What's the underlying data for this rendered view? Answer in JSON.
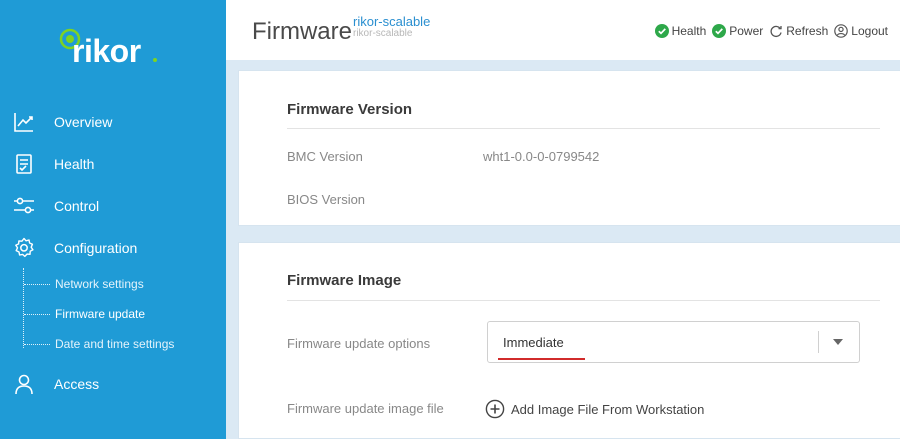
{
  "brand": {
    "logo_text": "rikor"
  },
  "sidebar": {
    "items": [
      {
        "label": "Overview",
        "icon": "chart-line-icon"
      },
      {
        "label": "Health",
        "icon": "clipboard-check-icon"
      },
      {
        "label": "Control",
        "icon": "sliders-icon"
      },
      {
        "label": "Configuration",
        "icon": "gear-icon"
      },
      {
        "label": "Access",
        "icon": "user-icon"
      }
    ],
    "sub_items": [
      {
        "label": "Network settings"
      },
      {
        "label": "Firmware update",
        "active": true
      },
      {
        "label": "Date and time settings"
      }
    ]
  },
  "header": {
    "title": "Firmware",
    "host_name": "rikor-scalable",
    "host_sub": "rikor-scalable",
    "actions": [
      {
        "label": "Health",
        "icon": "check-circle-icon",
        "color": "#2ea84a"
      },
      {
        "label": "Power",
        "icon": "check-circle-icon",
        "color": "#2ea84a"
      },
      {
        "label": "Refresh",
        "icon": "refresh-icon"
      },
      {
        "label": "Logout",
        "icon": "user-circle-icon"
      }
    ]
  },
  "firmware_version": {
    "title": "Firmware Version",
    "rows": [
      {
        "label": "BMC Version",
        "value": "wht1-0.0-0-0799542"
      },
      {
        "label": "BIOS Version",
        "value": ""
      }
    ]
  },
  "firmware_image": {
    "title": "Firmware Image",
    "options_label": "Firmware update options",
    "options_value": "Immediate",
    "file_label": "Firmware update image file",
    "add_button_label": "Add Image File From Workstation"
  },
  "colors": {
    "sidebar_bg": "#1f9bd6",
    "accent": "#2a8fd0",
    "ok": "#2ea84a",
    "underline": "#d12b2b"
  }
}
